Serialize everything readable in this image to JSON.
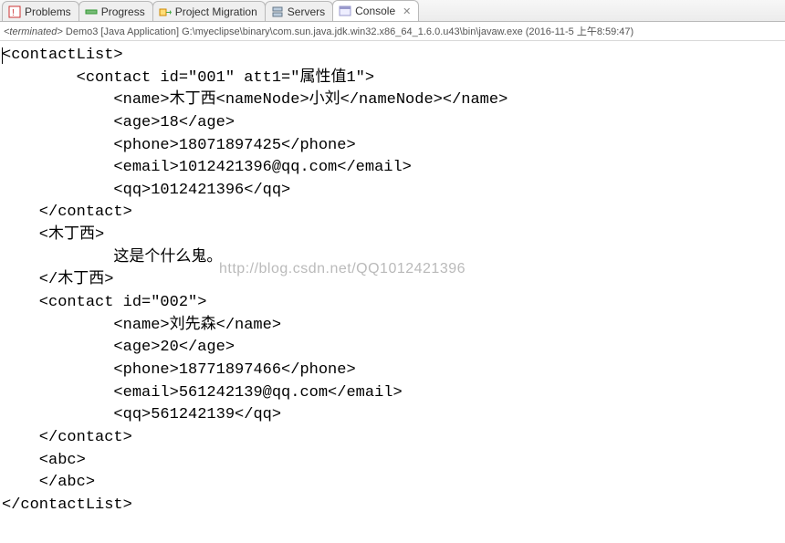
{
  "tabs": [
    {
      "label": "Problems",
      "icon": "problems"
    },
    {
      "label": "Progress",
      "icon": "progress"
    },
    {
      "label": "Project Migration",
      "icon": "migration"
    },
    {
      "label": "Servers",
      "icon": "servers"
    },
    {
      "label": "Console",
      "icon": "console",
      "active": true,
      "closable": true
    }
  ],
  "status": {
    "prefix": "<terminated>",
    "app": "Demo3 [Java Application]",
    "path": "G:\\myeclipse\\binary\\com.sun.java.jdk.win32.x86_64_1.6.0.u43\\bin\\javaw.exe",
    "time": "(2016-11-5 上午8:59:47)"
  },
  "console_lines": [
    "<contactList>",
    "        <contact id=\"001\" att1=\"属性值1\">",
    "            <name>木丁西<nameNode>小刘</nameNode></name>",
    "            <age>18</age>",
    "            <phone>18071897425</phone>",
    "            <email>1012421396@qq.com</email>",
    "            <qq>1012421396</qq>",
    "    </contact>",
    "    <木丁西>",
    "            这是个什么鬼。",
    "    </木丁西>",
    "    <contact id=\"002\">",
    "            <name>刘先森</name>",
    "            <age>20</age>",
    "            <phone>18771897466</phone>",
    "            <email>561242139@qq.com</email>",
    "            <qq>561242139</qq>",
    "    </contact>",
    "    <abc>",
    "    </abc>",
    "</contactList>"
  ],
  "watermark": "http://blog.csdn.net/QQ1012421396"
}
